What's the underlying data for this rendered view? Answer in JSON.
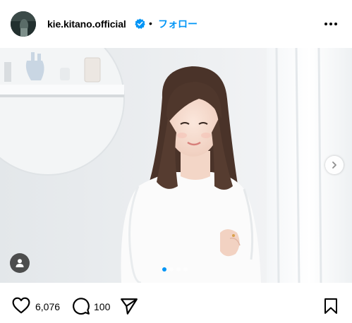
{
  "post": {
    "username": "kie.kitano.official",
    "separator": "•",
    "follow_label": "フォロー"
  },
  "icons": {
    "verified": "verified-badge-icon",
    "more": "more-options-icon",
    "next": "chevron-right-icon",
    "user_tag": "user-tag-icon",
    "like": "heart-icon",
    "comment": "comment-icon",
    "share": "share-icon",
    "save": "bookmark-icon"
  },
  "carousel": {
    "slide_count": 4,
    "active_index": 0
  },
  "stats": {
    "likes": "6,076",
    "comments": "100"
  },
  "colors": {
    "accent": "#0095f6",
    "verified": "#0095f6"
  }
}
